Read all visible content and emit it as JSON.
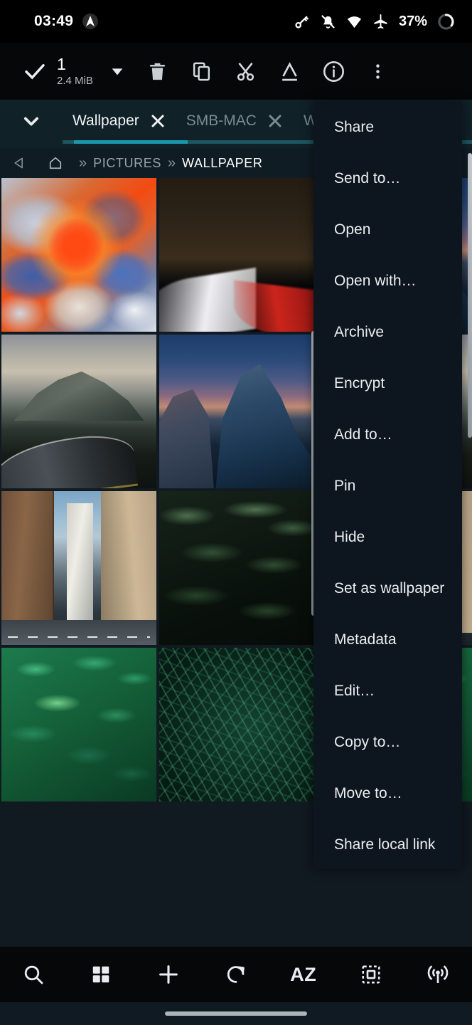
{
  "status_bar": {
    "clock": "03:49",
    "battery_percent": "37%",
    "icons": [
      "app-logo-icon",
      "vpn-key-icon",
      "notifications-off-icon",
      "wifi-icon",
      "airplane-mode-icon",
      "battery-circle-icon"
    ]
  },
  "action_bar": {
    "selected_count": "1",
    "selected_size": "2.4 MiB",
    "icons": [
      "check-icon",
      "dropdown-arrow-icon",
      "delete-icon",
      "copy-icon",
      "cut-icon",
      "rename-icon",
      "info-icon",
      "more-options-icon"
    ]
  },
  "tab_bar": {
    "expand_icon": "chevron-down-icon",
    "tabs": [
      {
        "label": "Wallpaper",
        "active": true,
        "close_icon": "close-icon"
      },
      {
        "label": "SMB-MAC",
        "active": false,
        "close_icon": "close-icon"
      },
      {
        "label": "W",
        "active": false,
        "close_icon": "close-icon"
      }
    ],
    "accent_color": "#1b96ab",
    "track_color": "#1d565f"
  },
  "breadcrumb": {
    "back_icon": "back-triangle-icon",
    "home_icon": "home-icon",
    "separator": "»",
    "crumbs": [
      "PICTURES",
      "WALLPAPER"
    ],
    "current": "WALLPAPER"
  },
  "grid": {
    "columns": 3,
    "items": [
      {
        "name": "paint-explosion-thumbnail",
        "art": "art-paint",
        "selected": true
      },
      {
        "name": "night-highway-thumbnail",
        "art": "art-highway",
        "selected": false
      },
      {
        "name": "hidden-thumbnail-r1c3",
        "art": "art-halfdome",
        "selected": false
      },
      {
        "name": "mountain-road-thumbnail",
        "art": "art-mtroad",
        "selected": false
      },
      {
        "name": "half-dome-twilight-thumbnail",
        "art": "art-halfdome",
        "selected": false
      },
      {
        "name": "hidden-thumbnail-r2c3",
        "art": "art-mtroad",
        "selected": false
      },
      {
        "name": "city-skyscraper-thumbnail",
        "art": "art-city",
        "selected": false
      },
      {
        "name": "dark-palm-leaves-thumbnail",
        "art": "art-palm",
        "selected": false
      },
      {
        "name": "hidden-thumbnail-r3c3",
        "art": "art-city",
        "selected": false
      },
      {
        "name": "green-fern-thumbnail",
        "art": "art-fern",
        "selected": false
      },
      {
        "name": "dark-grass-thumbnail",
        "art": "art-grass",
        "selected": false
      },
      {
        "name": "hidden-thumbnail-r4c3",
        "art": "art-fern",
        "selected": false
      }
    ]
  },
  "context_menu": {
    "items": [
      "Share",
      "Send to…",
      "Open",
      "Open with…",
      "Archive",
      "Encrypt",
      "Add to…",
      "Pin",
      "Hide",
      "Set as wallpaper",
      "Metadata",
      "Edit…",
      "Copy to…",
      "Move to…",
      "Share local link"
    ],
    "background_color": "#0d161e"
  },
  "bottom_bar": {
    "buttons": [
      {
        "name": "search-button",
        "icon": "search-icon",
        "label": ""
      },
      {
        "name": "view-mode-button",
        "icon": "grid-view-icon",
        "label": ""
      },
      {
        "name": "add-button",
        "icon": "plus-icon",
        "label": ""
      },
      {
        "name": "refresh-button",
        "icon": "refresh-icon",
        "label": ""
      },
      {
        "name": "sort-button",
        "icon": "sort-az-icon",
        "label": "AZ"
      },
      {
        "name": "select-all-button",
        "icon": "select-all-icon",
        "label": ""
      },
      {
        "name": "cast-button",
        "icon": "broadcast-icon",
        "label": ""
      }
    ]
  },
  "nav_bar": {
    "handle": "gesture-nav-handle"
  },
  "theme": {
    "background": "#111a21",
    "bar_background": "#050709",
    "tab_background": "#102128",
    "breadcrumb_background": "#101c24",
    "accent": "#1b96ab",
    "text_primary": "#eceff1",
    "text_secondary": "#8b949c"
  }
}
